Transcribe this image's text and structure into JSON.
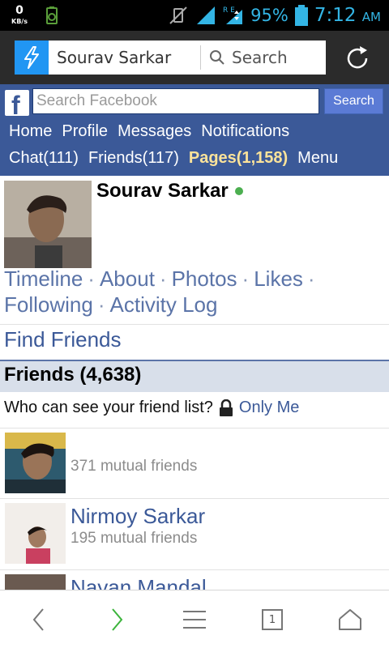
{
  "status_bar": {
    "net_speed": "0",
    "net_unit": "KB/s",
    "network_tag": "R E",
    "battery_percent": "95%",
    "time": "7:12",
    "time_suffix": "AM",
    "icons": [
      "battery-saver-icon",
      "vibrate-off-icon",
      "signal-icon",
      "roaming-data-icon",
      "battery-icon"
    ]
  },
  "browser": {
    "tab_title": "Sourav Sarkar",
    "search_label": "Search",
    "icons": [
      "lightning-icon",
      "search-icon",
      "refresh-icon"
    ]
  },
  "facebook": {
    "search_placeholder": "Search Facebook",
    "search_button": "Search",
    "nav_row1": [
      "Home",
      "Profile",
      "Messages",
      "Notifications"
    ],
    "nav_row2": [
      "Chat(111)",
      "Friends(117)",
      "Pages(1,158)",
      "Menu"
    ],
    "accent_color": "#3b5998",
    "highlight_color": "#fce39a"
  },
  "profile": {
    "name": "Sourav Sarkar",
    "online_status_color": "#4caf50",
    "links": [
      "Timeline",
      "About",
      "Photos",
      "Likes",
      "Following",
      "Activity Log"
    ],
    "find_friends": "Find Friends",
    "friends_header": "Friends (4,638)",
    "privacy_question": "Who can see your friend list?",
    "privacy_value": "Only Me"
  },
  "friends": [
    {
      "name": "",
      "mutual": "371 mutual friends"
    },
    {
      "name": "Nirmoy Sarkar",
      "mutual": "195 mutual friends"
    },
    {
      "name": "Nayan Mandal",
      "mutual": ""
    }
  ],
  "bottom_bar": {
    "tab_count": "1",
    "icons": [
      "back-icon",
      "forward-icon",
      "menu-icon",
      "tabs-icon",
      "home-icon"
    ]
  }
}
